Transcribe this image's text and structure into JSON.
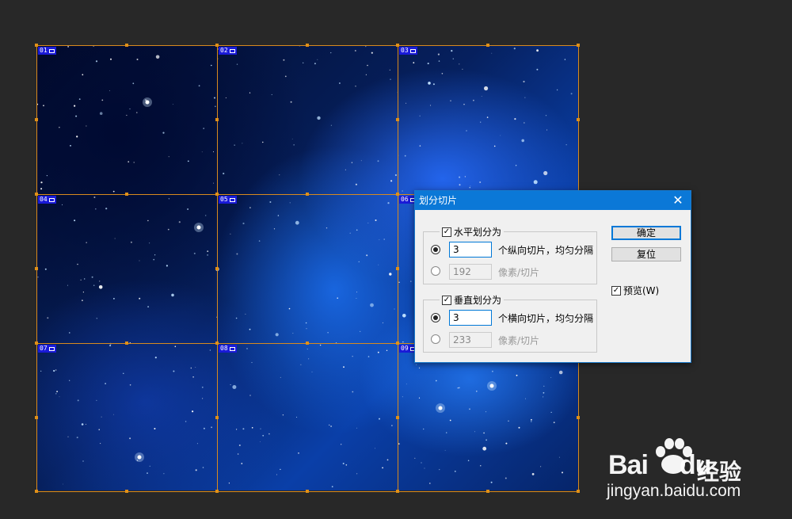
{
  "canvas": {
    "slice_numbers": [
      "01",
      "02",
      "03",
      "04",
      "05",
      "06",
      "07",
      "08",
      "09"
    ],
    "accent_guide_color": "#d88a1e",
    "badge_color": "#1a1ad8"
  },
  "dialog": {
    "title": "划分切片",
    "close_glyph": "✕",
    "horizontal": {
      "checkbox_label": "水平划分为",
      "checked": true,
      "count_value": "3",
      "count_label": "个纵向切片，均匀分隔",
      "pixels_value": "192",
      "pixels_label": "像素/切片"
    },
    "vertical": {
      "checkbox_label": "垂直划分为",
      "checked": true,
      "count_value": "3",
      "count_label": "个横向切片，均匀分隔",
      "pixels_value": "233",
      "pixels_label": "像素/切片"
    },
    "ok_label": "确定",
    "reset_label": "复位",
    "preview_label": "预览(W)",
    "preview_checked": true
  },
  "watermark": {
    "brand": "Bai",
    "brand_tail": "du",
    "brand_cn": "经验",
    "url": "jingyan.baidu.com"
  }
}
